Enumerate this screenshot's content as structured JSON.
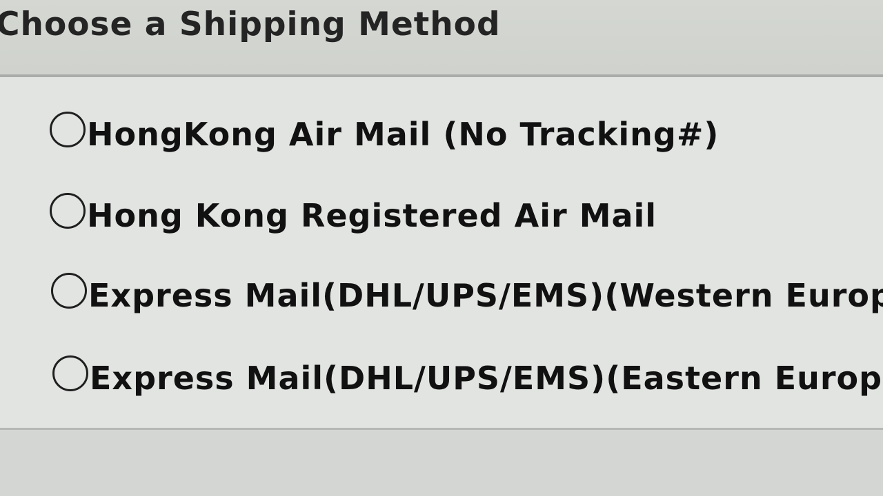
{
  "shipping": {
    "title": "Choose a Shipping Method",
    "options": [
      {
        "label": "HongKong Air Mail (No Tracking#)",
        "selected": false
      },
      {
        "label": "Hong Kong Registered Air Mail",
        "selected": false
      },
      {
        "label": "Express Mail(DHL/UPS/EMS)(Western Europ",
        "selected": false
      },
      {
        "label": "Express Mail(DHL/UPS/EMS)(Eastern Europ",
        "selected": false
      }
    ]
  },
  "icons": {
    "radio": "radio-unchecked-icon"
  },
  "colors": {
    "text": "#111111",
    "panel_background": "#e1e4e1",
    "header_background": "#d4d7d2",
    "border": "#a9aca8"
  }
}
